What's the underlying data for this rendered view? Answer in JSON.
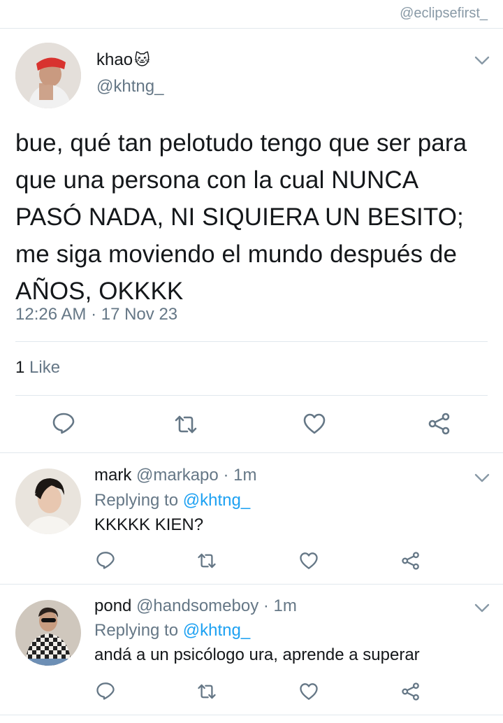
{
  "watermark": "@eclipsefirst_",
  "main_tweet": {
    "name": "khao",
    "emoji": "🐱",
    "handle": "@khtng_",
    "text": "bue, qué tan pelotudo tengo que ser para que una persona con la cual NUNCA PASÓ NADA, NI SIQUIERA UN BESITO; me siga moviendo el mundo después de AÑOS, OKKKK",
    "time": "12:26 AM · 17 Nov 23",
    "likes_count": "1",
    "likes_label": "Like"
  },
  "replies": [
    {
      "name": "mark",
      "handle": "@markapo",
      "time": "· 1m",
      "replying_prefix": "Replying to",
      "replying_to": "@khtng_",
      "text": "KKKKK KIEN?"
    },
    {
      "name": "pond",
      "handle": "@handsomeboy",
      "time": "· 1m",
      "replying_prefix": "Replying to",
      "replying_to": "@khtng_",
      "text": "andá a un psicólogo ura, aprende a superar"
    }
  ],
  "icons": {
    "reply": "reply-icon",
    "retweet": "retweet-icon",
    "like": "heart-icon",
    "share": "share-icon",
    "more": "chevron-down-icon"
  },
  "colors": {
    "icon_gray": "#657786",
    "link_blue": "#1da1f2",
    "divider": "#e1e8ed"
  }
}
